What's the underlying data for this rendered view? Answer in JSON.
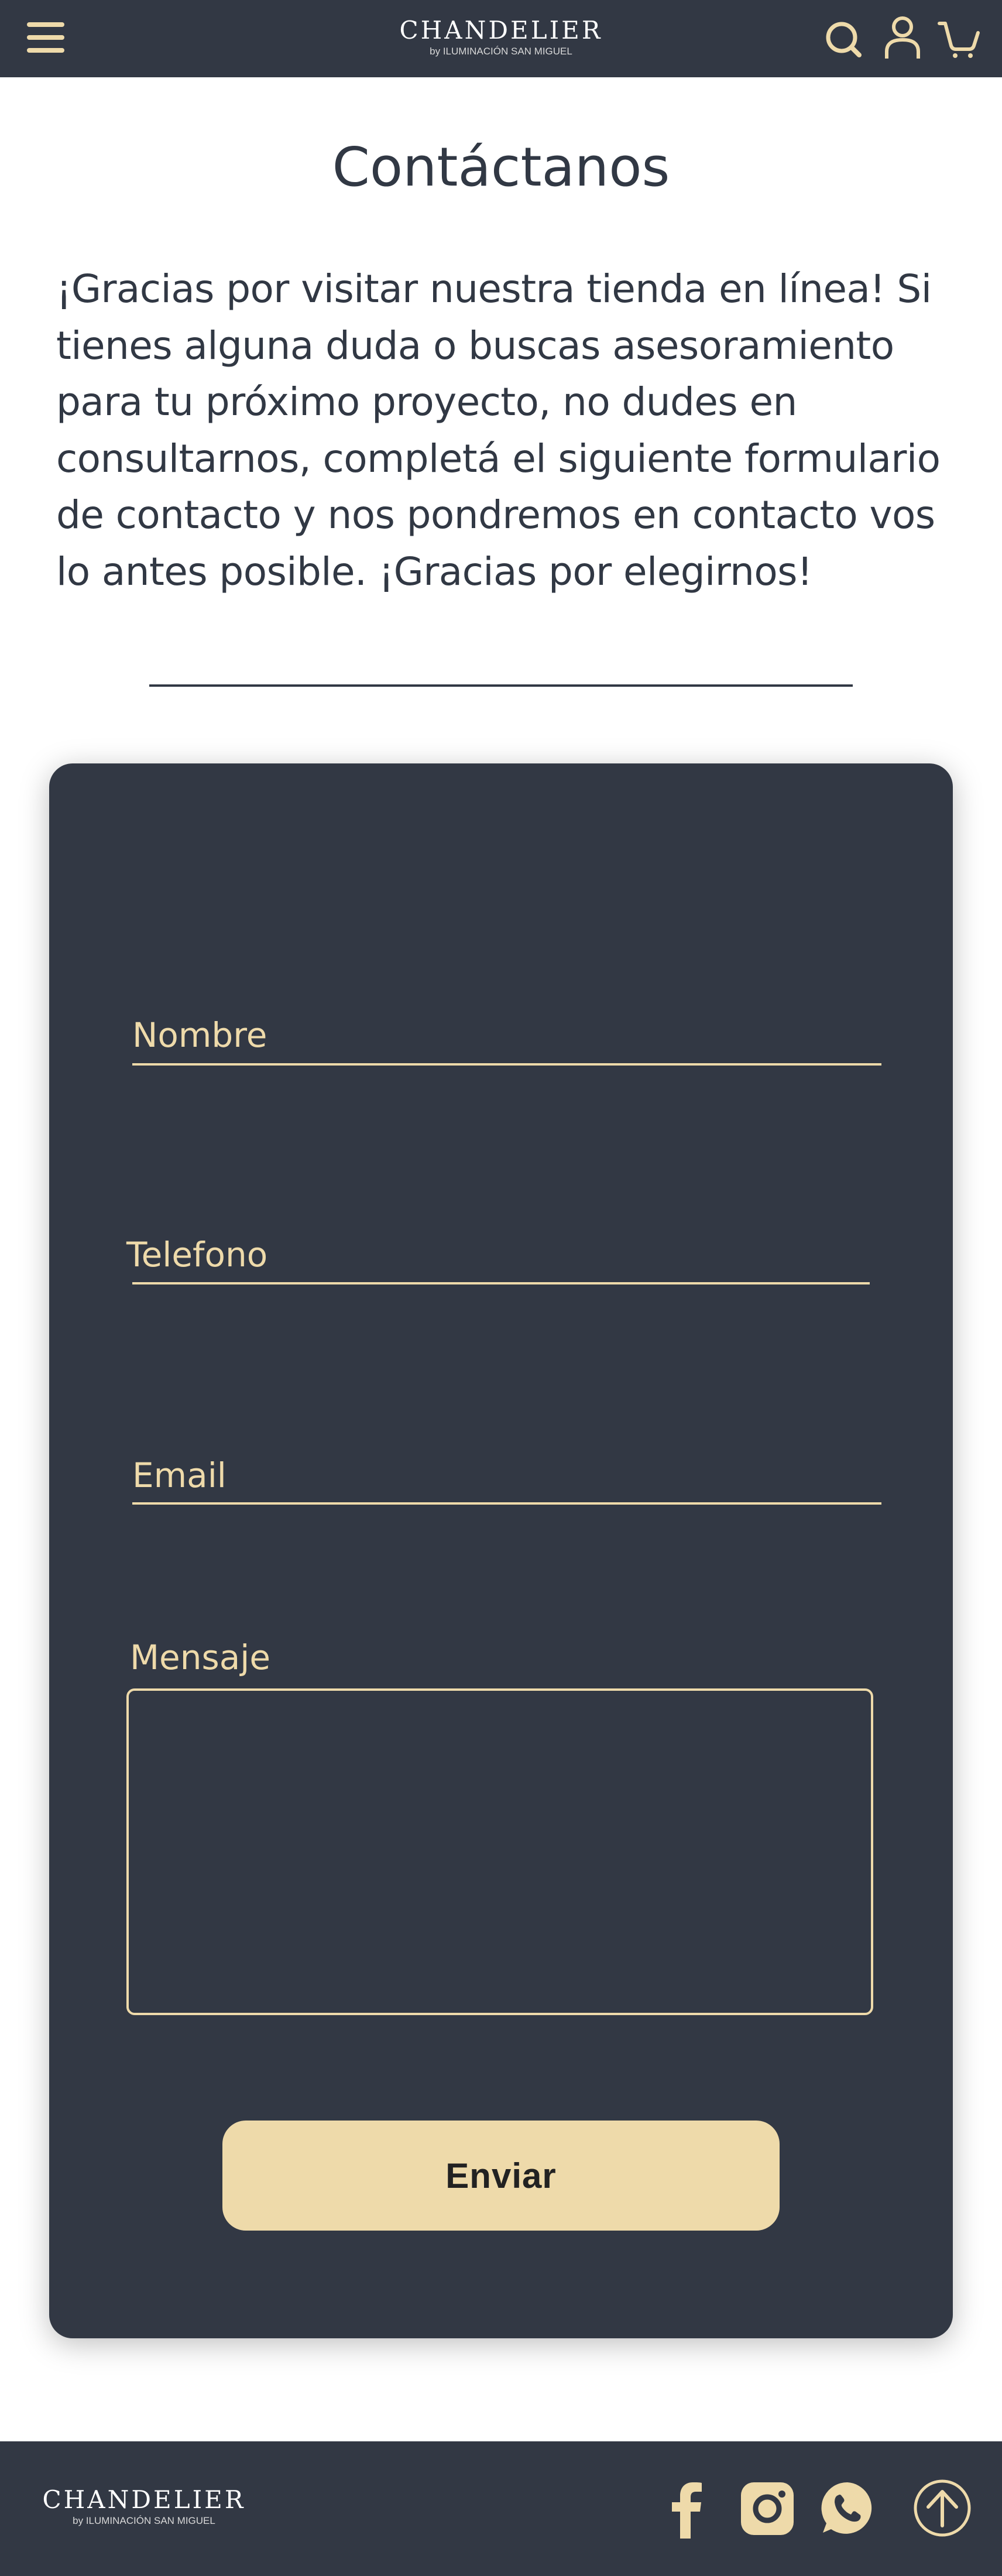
{
  "header": {
    "brand": "CHANDELIER",
    "tagline": "by ILUMINACIÓN SAN MIGUEL",
    "icons": [
      "menu-icon",
      "search-icon",
      "user-icon",
      "cart-icon"
    ]
  },
  "page": {
    "title": "Contáctanos",
    "intro": "¡Gracias por visitar nuestra tienda en línea! Si tienes alguna duda o buscas asesoramiento para tu próximo proyecto, no dudes en consultarnos, completá el siguiente formulario de contacto y nos pondremos en contacto vos lo antes posible. ¡Gracias por elegirnos!"
  },
  "form": {
    "name_label": "Nombre",
    "phone_label": "Telefono",
    "email_label": "Email",
    "message_label": "Mensaje",
    "submit_label": "Enviar"
  },
  "footer": {
    "brand": "CHANDELIER",
    "tagline": "by ILUMINACIÓN SAN MIGUEL",
    "icons": [
      "facebook-icon",
      "instagram-icon",
      "whatsapp-icon",
      "scroll-top-icon"
    ]
  },
  "colors": {
    "dark": "#323844",
    "accent": "#eedaaa",
    "text": "#313844",
    "background": "#ffffff"
  }
}
